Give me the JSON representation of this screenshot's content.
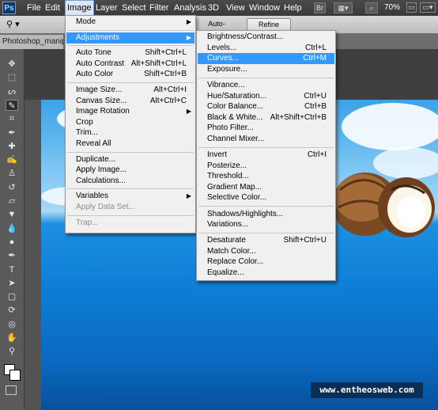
{
  "menubar": {
    "logo": "Ps",
    "items": [
      "File",
      "Edit",
      "Image",
      "Layer",
      "Select",
      "Filter",
      "Analysis",
      "3D",
      "View",
      "Window",
      "Help"
    ],
    "bridge_label": "Br",
    "zoom": "70%"
  },
  "options": {
    "auto_enhance": "Auto-Enhance",
    "refine_edge": "Refine Edge..."
  },
  "document": {
    "tab_title": "Photoshop_manipu"
  },
  "watermark": "www.entheosweb.com",
  "image_menu": [
    {
      "label": "Mode",
      "arrow": true
    },
    {
      "sep": true
    },
    {
      "label": "Adjustments",
      "arrow": true,
      "highlight": true
    },
    {
      "sep": true
    },
    {
      "label": "Auto Tone",
      "shortcut": "Shift+Ctrl+L"
    },
    {
      "label": "Auto Contrast",
      "shortcut": "Alt+Shift+Ctrl+L"
    },
    {
      "label": "Auto Color",
      "shortcut": "Shift+Ctrl+B"
    },
    {
      "sep": true
    },
    {
      "label": "Image Size...",
      "shortcut": "Alt+Ctrl+I"
    },
    {
      "label": "Canvas Size...",
      "shortcut": "Alt+Ctrl+C"
    },
    {
      "label": "Image Rotation",
      "arrow": true
    },
    {
      "label": "Crop"
    },
    {
      "label": "Trim..."
    },
    {
      "label": "Reveal All"
    },
    {
      "sep": true
    },
    {
      "label": "Duplicate..."
    },
    {
      "label": "Apply Image..."
    },
    {
      "label": "Calculations..."
    },
    {
      "sep": true
    },
    {
      "label": "Variables",
      "arrow": true
    },
    {
      "label": "Apply Data Set...",
      "disabled": true
    },
    {
      "sep": true
    },
    {
      "label": "Trap...",
      "disabled": true
    }
  ],
  "adjust_menu": [
    {
      "label": "Brightness/Contrast..."
    },
    {
      "label": "Levels...",
      "shortcut": "Ctrl+L"
    },
    {
      "label": "Curves...",
      "shortcut": "Ctrl+M",
      "highlight": true
    },
    {
      "label": "Exposure..."
    },
    {
      "sep": true
    },
    {
      "label": "Vibrance..."
    },
    {
      "label": "Hue/Saturation...",
      "shortcut": "Ctrl+U"
    },
    {
      "label": "Color Balance...",
      "shortcut": "Ctrl+B"
    },
    {
      "label": "Black & White...",
      "shortcut": "Alt+Shift+Ctrl+B"
    },
    {
      "label": "Photo Filter..."
    },
    {
      "label": "Channel Mixer..."
    },
    {
      "sep": true
    },
    {
      "label": "Invert",
      "shortcut": "Ctrl+I"
    },
    {
      "label": "Posterize..."
    },
    {
      "label": "Threshold..."
    },
    {
      "label": "Gradient Map..."
    },
    {
      "label": "Selective Color..."
    },
    {
      "sep": true
    },
    {
      "label": "Shadows/Highlights..."
    },
    {
      "label": "Variations..."
    },
    {
      "sep": true
    },
    {
      "label": "Desaturate",
      "shortcut": "Shift+Ctrl+U"
    },
    {
      "label": "Match Color..."
    },
    {
      "label": "Replace Color..."
    },
    {
      "label": "Equalize..."
    }
  ],
  "tools": [
    "move-icon",
    "marquee-icon",
    "lasso-icon",
    "quick-select-icon",
    "crop-icon",
    "eyedropper-icon",
    "healing-icon",
    "brush-icon",
    "stamp-icon",
    "history-brush-icon",
    "eraser-icon",
    "paint-bucket-icon",
    "blur-icon",
    "dodge-icon",
    "pen-icon",
    "type-icon",
    "path-select-icon",
    "shape-icon",
    "3d-rotate-icon",
    "3d-orbit-icon",
    "hand-icon",
    "zoom-icon"
  ]
}
